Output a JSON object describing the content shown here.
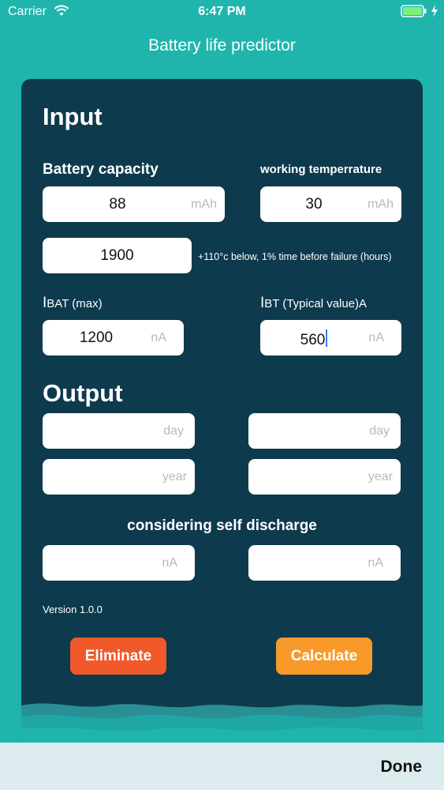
{
  "status_bar": {
    "carrier": "Carrier",
    "time": "6:47 PM"
  },
  "app": {
    "title": "Battery life predictor"
  },
  "input": {
    "heading": "Input",
    "battery_capacity_label": "Battery capacity",
    "working_temp_label": "working temperrature",
    "capacity": {
      "value": "88",
      "unit": "mAh"
    },
    "temperature": {
      "value": "30",
      "unit": "mAh"
    },
    "hours": {
      "value": "1900",
      "note": "+110°c below, 1% time before failure (hours)"
    },
    "ibat_label": {
      "prefix": "I",
      "rest": "BAT (max)"
    },
    "ibt_label": {
      "prefix": "I",
      "rest": "BT (Typical value)A"
    },
    "ibat": {
      "value": "1200",
      "unit": "nA"
    },
    "ibt": {
      "value": "560",
      "unit": "nA"
    }
  },
  "output": {
    "heading": "Output",
    "day_unit": "day",
    "year_unit": "year",
    "self_discharge_label": "considering self discharge",
    "na_unit": "nA"
  },
  "version": "Version 1.0.0",
  "buttons": {
    "eliminate": "Eliminate",
    "calculate": "Calculate",
    "done": "Done"
  },
  "colors": {
    "background": "#1fb5ad",
    "card": "#0e3a4d",
    "eliminate": "#f05a2a",
    "calculate": "#f79a2a"
  }
}
